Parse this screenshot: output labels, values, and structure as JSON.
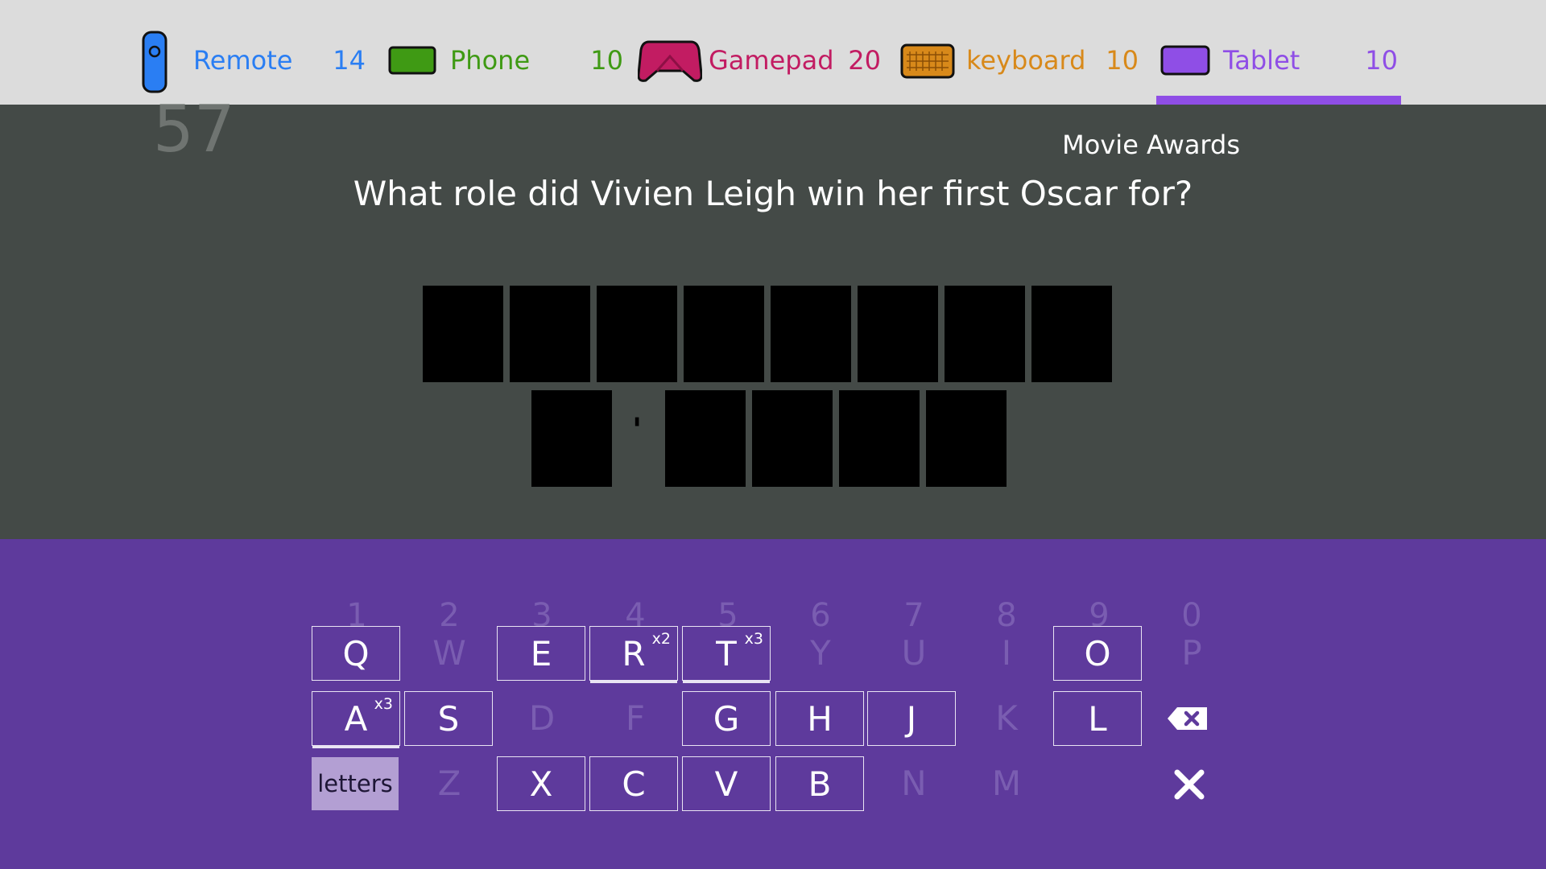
{
  "players": [
    {
      "name": "Remote",
      "score": "14",
      "color": "#2a7ef3",
      "icon": "remote-icon"
    },
    {
      "name": "Phone",
      "score": "10",
      "color": "#3f9a14",
      "icon": "phone-icon"
    },
    {
      "name": "Gamepad",
      "score": "20",
      "color": "#c21c62",
      "icon": "gamepad-icon"
    },
    {
      "name": "keyboard",
      "score": "10",
      "color": "#d8891a",
      "icon": "keyboard-icon"
    },
    {
      "name": "Tablet",
      "score": "10",
      "color": "#8f4ee6",
      "icon": "tablet-icon"
    }
  ],
  "active_player": "Tablet",
  "timer": "57",
  "category": "Movie Awards",
  "question": "What role did Vivien Leigh win her first Oscar for?",
  "answer": {
    "row1_tiles": 8,
    "row2_first_word": 1,
    "row2_separator": "'",
    "row2_second_word": 4
  },
  "keyboard": {
    "numbers": [
      "1",
      "2",
      "3",
      "4",
      "5",
      "6",
      "7",
      "8",
      "9",
      "0"
    ],
    "row1": [
      {
        "label": "Q",
        "available": true,
        "mult": ""
      },
      {
        "label": "W",
        "available": false,
        "mult": ""
      },
      {
        "label": "E",
        "available": true,
        "mult": ""
      },
      {
        "label": "R",
        "available": true,
        "mult": "x2"
      },
      {
        "label": "T",
        "available": true,
        "mult": "x3"
      },
      {
        "label": "Y",
        "available": false,
        "mult": ""
      },
      {
        "label": "U",
        "available": false,
        "mult": ""
      },
      {
        "label": "I",
        "available": false,
        "mult": ""
      },
      {
        "label": "O",
        "available": true,
        "mult": ""
      },
      {
        "label": "P",
        "available": false,
        "mult": ""
      }
    ],
    "row2": [
      {
        "label": "A",
        "available": true,
        "mult": "x3"
      },
      {
        "label": "S",
        "available": true,
        "mult": ""
      },
      {
        "label": "D",
        "available": false,
        "mult": ""
      },
      {
        "label": "F",
        "available": false,
        "mult": ""
      },
      {
        "label": "G",
        "available": true,
        "mult": ""
      },
      {
        "label": "H",
        "available": true,
        "mult": ""
      },
      {
        "label": "J",
        "available": true,
        "mult": ""
      },
      {
        "label": "K",
        "available": false,
        "mult": ""
      },
      {
        "label": "L",
        "available": true,
        "mult": ""
      }
    ],
    "row3": [
      {
        "label": "Z",
        "available": false,
        "mult": ""
      },
      {
        "label": "X",
        "available": true,
        "mult": ""
      },
      {
        "label": "C",
        "available": true,
        "mult": ""
      },
      {
        "label": "V",
        "available": true,
        "mult": ""
      },
      {
        "label": "B",
        "available": true,
        "mult": ""
      },
      {
        "label": "N",
        "available": false,
        "mult": ""
      },
      {
        "label": "M",
        "available": false,
        "mult": ""
      }
    ],
    "letters_label": "letters"
  },
  "colors": {
    "topbar": "#dcdcdc",
    "question_bg": "#444a47",
    "keyboard_bg": "#5e3a9c",
    "accent": "#8f4ee6"
  }
}
